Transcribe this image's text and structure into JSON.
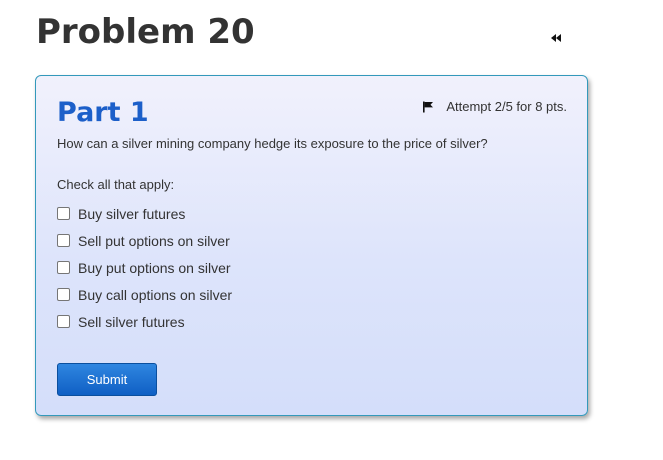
{
  "problem": {
    "title": "Problem 20"
  },
  "part": {
    "title": "Part 1",
    "attempt_text": "Attempt 2/5 for 8 pts.",
    "question": "How can a silver mining company hedge its exposure to the price of silver?",
    "instructions": "Check all that apply:",
    "options": [
      {
        "label": "Buy silver futures",
        "checked": false
      },
      {
        "label": "Sell put options on silver",
        "checked": false
      },
      {
        "label": "Buy put options on silver",
        "checked": false
      },
      {
        "label": "Buy call options on silver",
        "checked": false
      },
      {
        "label": "Sell silver futures",
        "checked": false
      }
    ],
    "submit_label": "Submit"
  },
  "icons": {
    "collapse": "double-chevron-left-icon",
    "flag": "flag-icon"
  },
  "colors": {
    "accent": "#1c5fc9",
    "card_border": "#3399bb",
    "submit_bg": "#0f5fc4"
  }
}
